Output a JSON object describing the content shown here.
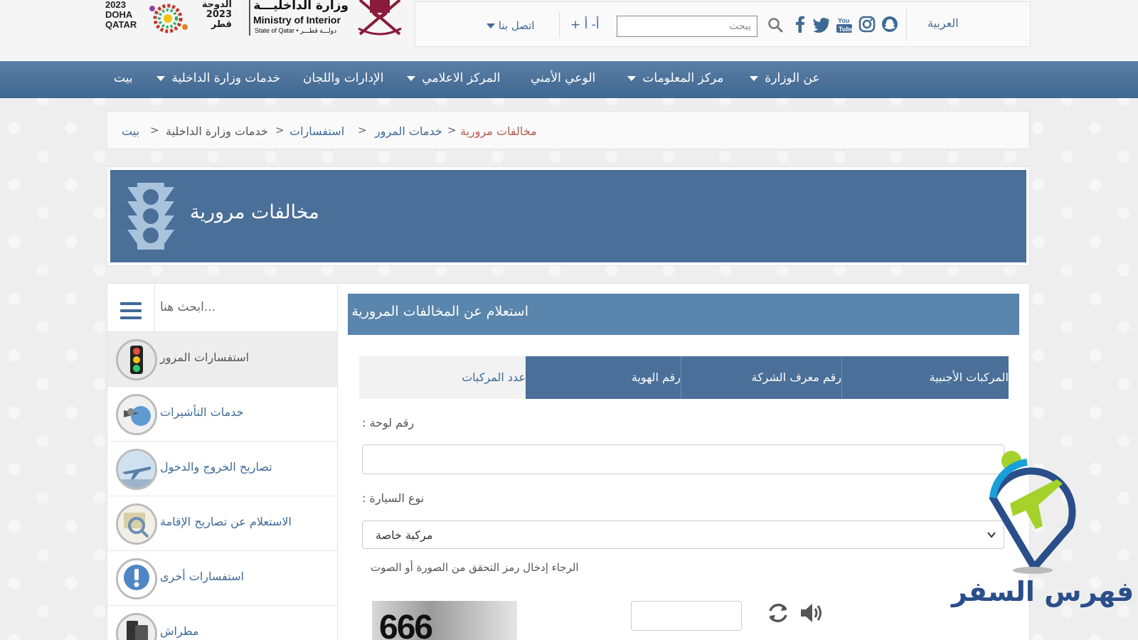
{
  "header": {
    "logo_2023_en": "2023 DOHA QATAR",
    "logo_2023_ar": "الدوحة 2023 قطر",
    "ministry_ar": "وزارة الداخليـــة",
    "ministry_en": "Ministry of Interior",
    "ministry_sub": "State of Qatar • دولـــة قطـــر",
    "lang_label": "العربية",
    "search_placeholder": "يبحث",
    "font_controls": "+ أ- أ",
    "contact_label": "اتصل بنا"
  },
  "nav": {
    "items": [
      {
        "label": "عن الوزارة",
        "has_dropdown": true
      },
      {
        "label": "مركز المعلومات",
        "has_dropdown": true
      },
      {
        "label": "الوعي الأمني",
        "has_dropdown": false
      },
      {
        "label": "المركز الاعلامي",
        "has_dropdown": true
      },
      {
        "label": "الإدارات واللجان",
        "has_dropdown": false
      },
      {
        "label": "خدمات وزارة الداخلية",
        "has_dropdown": true
      },
      {
        "label": "بيت",
        "has_dropdown": false
      }
    ]
  },
  "breadcrumb": {
    "items": [
      "بيت",
      "خدمات وزارة الداخلية",
      "استفسارات",
      "خدمات المرور",
      "مخالفات مرورية"
    ],
    "separator": ">"
  },
  "banner": {
    "title": "مخالفات مرورية",
    "icon": "traffic-light-icon"
  },
  "sidebar": {
    "search_placeholder": "...ابحث هنا",
    "items": [
      {
        "label": "استفسارات المرور",
        "icon": "traffic-light-icon",
        "active": true
      },
      {
        "label": "خدمات التأشيرات",
        "icon": "visa-services-icon",
        "active": false
      },
      {
        "label": "تصاريح الخروج والدخول",
        "icon": "airplane-icon",
        "active": false
      },
      {
        "label": "الاستعلام عن تصاريح الإقامة",
        "icon": "magnifier-card-icon",
        "active": false
      },
      {
        "label": "استفسارات أخرى",
        "icon": "exclamation-icon",
        "active": false
      },
      {
        "label": "مطراش",
        "icon": "mobile-app-icon",
        "active": false
      }
    ]
  },
  "panel": {
    "title": "استعلام عن المخالفات المرورية",
    "tabs": [
      {
        "label": "عدد المركبات",
        "active": false
      },
      {
        "label": "رقم الهوية",
        "active": true
      },
      {
        "label": "رقم معرف الشركة",
        "active": true
      },
      {
        "label": "المركبات الأجنبية",
        "active": true
      }
    ],
    "plate_label": "رقم لوحة :",
    "plate_value": "",
    "vehicle_type_label": "نوع السيارة :",
    "vehicle_type_value": "مركبة خاصة",
    "captcha_note": "الرجاء إدخال رمز التحقق من الصورة أو الصوت",
    "captcha_code": "666",
    "captcha_input_value": ""
  },
  "watermark": {
    "text": "فهرس السفر"
  },
  "colors": {
    "primary_blue": "#4a6f98",
    "panel_header": "#5a85ad",
    "link_blue": "#3e6a96",
    "breadcrumb_current": "#b25c4a",
    "watermark_blue": "#2a4e8a",
    "watermark_green": "#a5d22a"
  }
}
